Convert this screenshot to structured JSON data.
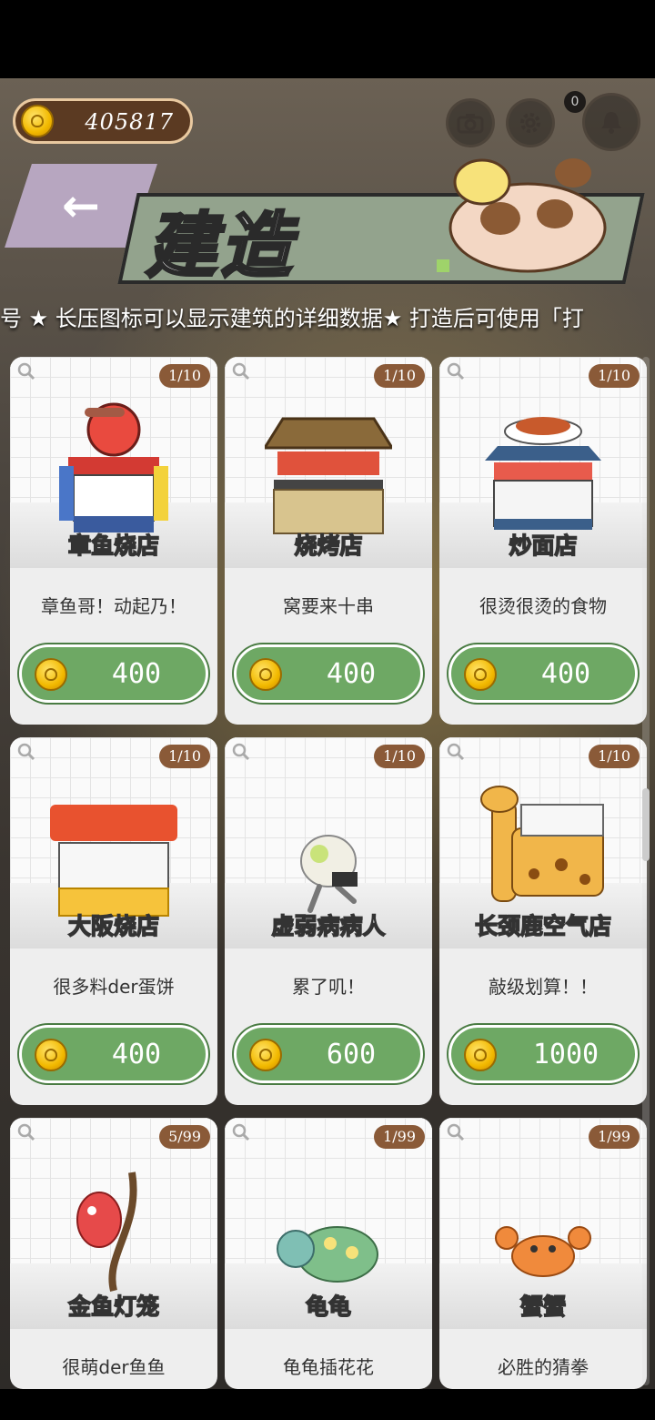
{
  "header": {
    "coins": "405817",
    "title": "建造",
    "back_arrow": "←",
    "notification_count": "0",
    "icons": [
      "camera-icon",
      "gear-icon",
      "bell-icon"
    ]
  },
  "marquee": "号    ★ 长压图标可以显示建筑的详细数据★ 打造后可使用「打",
  "colors": {
    "price_button": "#6ea864",
    "count_badge": "#8a5a38",
    "banner": "#93a38d",
    "back_button": "#b7a6c0"
  },
  "cards": [
    {
      "name": "章鱼烧店",
      "desc": "章鱼哥！动起乃！",
      "count": "1/10",
      "price": "400",
      "icon": "takoyaki-stand-icon"
    },
    {
      "name": "烧烤店",
      "desc": "窝要来十串",
      "count": "1/10",
      "price": "400",
      "icon": "yakiniku-stand-icon"
    },
    {
      "name": "炒面店",
      "desc": "很烫很烫的食物",
      "count": "1/10",
      "price": "400",
      "icon": "yakisoba-stand-icon"
    },
    {
      "name": "大阪烧店",
      "desc": "很多料der蛋饼",
      "count": "1/10",
      "price": "400",
      "icon": "okonomiyaki-stand-icon"
    },
    {
      "name": "虚弱病病人",
      "desc": "累了叽！",
      "count": "1/10",
      "price": "600",
      "icon": "sick-character-icon"
    },
    {
      "name": "长颈鹿空气店",
      "desc": "敲级划算！！",
      "count": "1/10",
      "price": "1000",
      "icon": "giraffe-stand-icon"
    },
    {
      "name": "金鱼灯笼",
      "desc": "很萌der鱼鱼",
      "count": "5/99",
      "price": "",
      "icon": "goldfish-lantern-icon"
    },
    {
      "name": "龟龟",
      "desc": "龟龟插花花",
      "count": "1/99",
      "price": "",
      "icon": "turtle-icon"
    },
    {
      "name": "蟹蟹",
      "desc": "必胜的猜拳",
      "count": "1/99",
      "price": "",
      "icon": "crab-icon"
    }
  ]
}
